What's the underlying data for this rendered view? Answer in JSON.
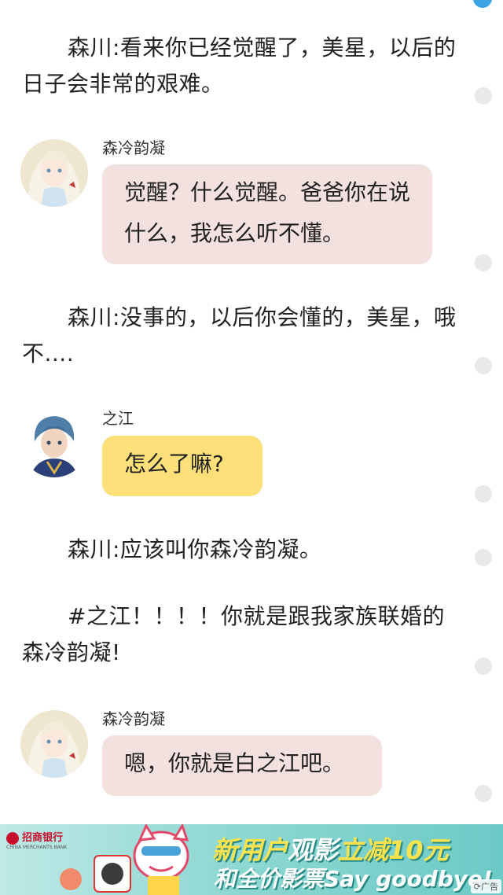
{
  "narration": [
    "森川:看来你已经觉醒了，美星，以后的日子会非常的艰难。",
    "森川:没事的，以后你会懂的，美星，哦不....",
    "森川:应该叫你森冷韵凝。",
    "#之江！！！！你就是跟我家族联婚的森冷韵凝!"
  ],
  "messages": [
    {
      "speaker": "森冷韵凝",
      "text": "觉醒？什么觉醒。爸爸你在说什么，我怎么听不懂。",
      "avatar": "girl-avatar"
    },
    {
      "speaker": "之江",
      "text": "怎么了嘛?",
      "avatar": "boy-avatar"
    },
    {
      "speaker": "森冷韵凝",
      "text": "嗯，你就是白之江吧。",
      "avatar": "girl-avatar"
    }
  ],
  "ad": {
    "bank_name": "招商银行",
    "bank_name_en": "CHINA MERCHANTS BANK",
    "line1_a": "新用户",
    "line1_b": "观影",
    "line1_c": "立减10元",
    "line2": "和全价影票Say goodbye!",
    "tag": "广告"
  },
  "colors": {
    "pink_bubble": "#f2e1df",
    "yellow_bubble": "#fde07a",
    "accent": "#3aa3e3"
  }
}
